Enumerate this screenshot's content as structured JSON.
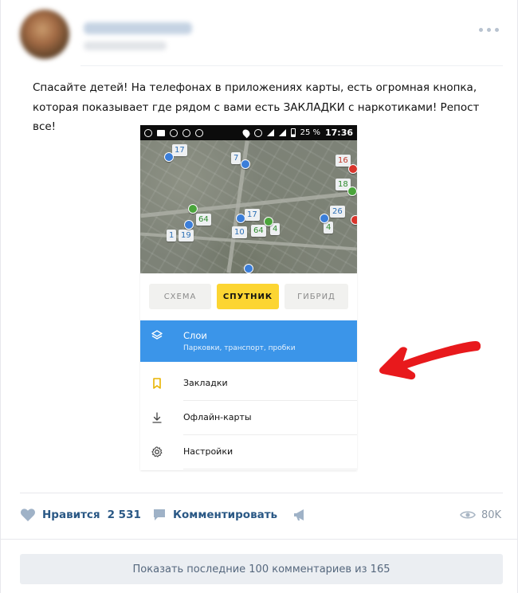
{
  "post": {
    "text": "Спасайте детей! На телефонах в приложениях карты, есть огромная кнопка, которая показывает где рядом с вами есть ЗАКЛАДКИ с наркотиками! Репост все!"
  },
  "phone": {
    "status": {
      "battery": "25 %",
      "time": "17:36"
    },
    "map_labels": [
      "17",
      "7",
      "16",
      "18",
      "26",
      "17",
      "64",
      "10",
      "64",
      "4",
      "4",
      "1",
      "19"
    ],
    "map_types": {
      "scheme": "СХЕМА",
      "satellite": "СПУТНИК",
      "hybrid": "ГИБРИД"
    },
    "layers": {
      "title": "Слои",
      "subtitle": "Парковки, транспорт, пробки"
    },
    "menu": [
      {
        "label": "Закладки",
        "icon": "bookmark-icon"
      },
      {
        "label": "Офлайн-карты",
        "icon": "download-icon"
      },
      {
        "label": "Настройки",
        "icon": "settings-icon"
      }
    ]
  },
  "actions": {
    "like_label": "Нравится",
    "like_count": "2 531",
    "comment_label": "Комментировать",
    "views": "80K"
  },
  "show_comments": "Показать последние 100 комментариев из 165",
  "colors": {
    "accent": "#2a5885",
    "layers_bg": "#3b95e9",
    "satellite_btn": "#fcd532",
    "arrow": "#e8191c"
  }
}
